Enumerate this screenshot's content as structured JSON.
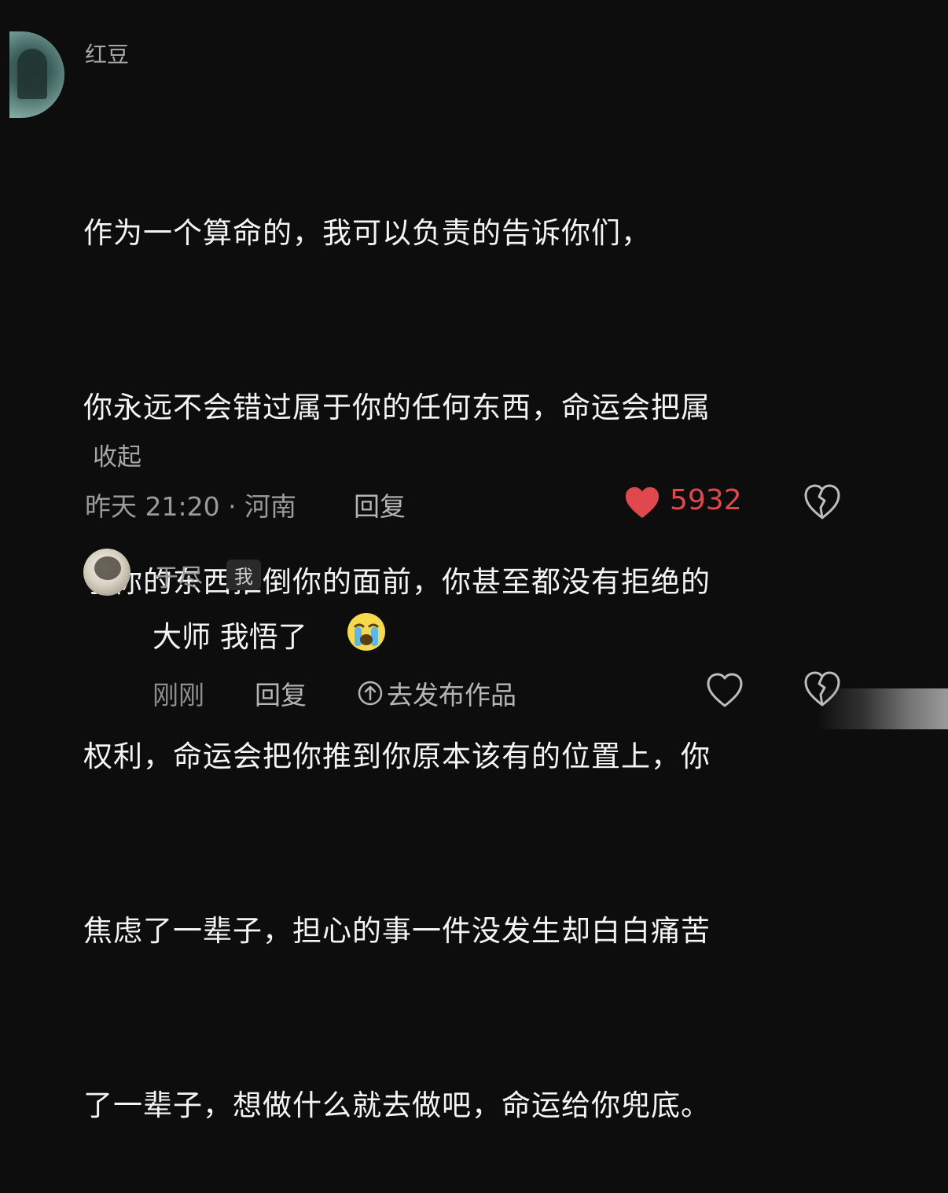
{
  "comment": {
    "username": "红豆",
    "lines": [
      "作为一个算命的，我可以负责的告诉你们，",
      "你永远不会错过属于你的任何东西，命运会把属",
      "于你的东西推倒你的面前，你甚至都没有拒绝的",
      "权利，命运会把你推到你原本该有的位置上，你",
      "焦虑了一辈子，担心的事一件没发生却白白痛苦",
      "了一辈子，想做什么就去做吧，命运给你兜底。"
    ],
    "collapse_label": "收起",
    "time_location": "昨天 21:20 · 河南",
    "reply_label": "回复",
    "like_count": "5932"
  },
  "reply": {
    "username": "于尽",
    "me_badge": "我",
    "text": "大师 我悟了",
    "time": "刚刚",
    "reply_label": "回复",
    "publish_label": "去发布作品"
  },
  "icons": {
    "like_filled": "heart-icon",
    "dislike": "broken-heart-icon",
    "like_outline": "heart-outline-icon",
    "publish": "arrow-up-circle-icon",
    "emoji": "loudly-crying-face-icon"
  },
  "colors": {
    "background": "#0d0d0d",
    "like_red": "#e0484d",
    "text_primary": "#f4f4f4",
    "text_secondary": "#9b9b9b"
  }
}
